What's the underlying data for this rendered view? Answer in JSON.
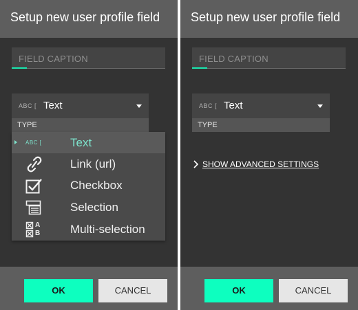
{
  "dialogs": [
    {
      "title": "Setup new user profile field",
      "caption_placeholder": "FIELD CAPTION",
      "type_select": {
        "abc_glyph": "ABC [",
        "value": "Text",
        "label": "TYPE"
      },
      "dropdown": {
        "items": [
          {
            "label": "Text",
            "icon": "text-type-icon",
            "selected": true
          },
          {
            "label": "Link (url)",
            "icon": "link-icon",
            "selected": false
          },
          {
            "label": "Checkbox",
            "icon": "checkbox-icon",
            "selected": false
          },
          {
            "label": "Selection",
            "icon": "selection-icon",
            "selected": false
          },
          {
            "label": "Multi-selection",
            "icon": "multi-selection-icon",
            "selected": false
          }
        ],
        "abc_glyph": "ABC [",
        "ab_glyph_a": "A",
        "ab_glyph_b": "B"
      },
      "buttons": {
        "ok": "OK",
        "cancel": "CANCEL"
      }
    },
    {
      "title": "Setup new user profile field",
      "caption_placeholder": "FIELD CAPTION",
      "type_select": {
        "abc_glyph": "ABC [",
        "value": "Text",
        "label": "TYPE"
      },
      "advanced_link": "SHOW ADVANCED SETTINGS",
      "buttons": {
        "ok": "OK",
        "cancel": "CANCEL"
      }
    }
  ],
  "colors": {
    "accent": "#0dffbf",
    "selected_text": "#7de3cc",
    "header_bg": "#5e5e5e",
    "body_bg": "#333333"
  }
}
